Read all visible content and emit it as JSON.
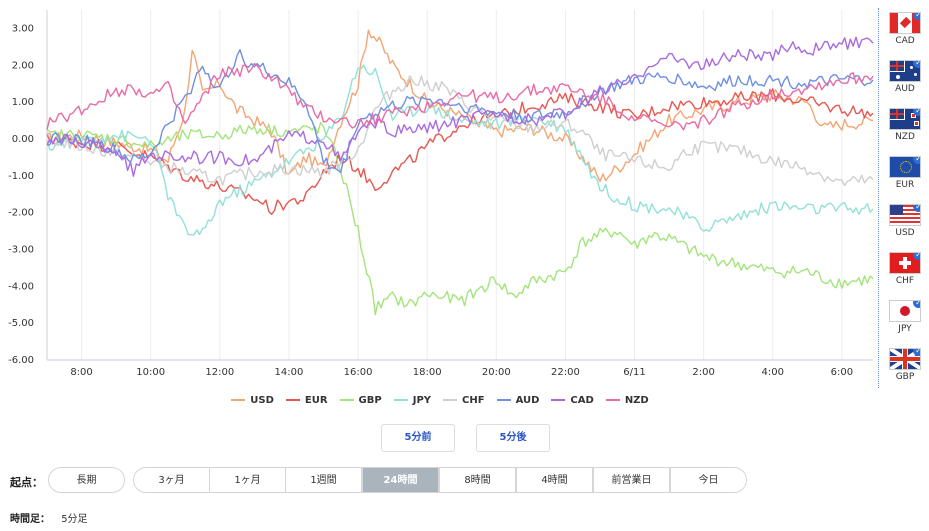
{
  "chart_data": {
    "type": "line",
    "x_ticks": [
      "8:00",
      "10:00",
      "12:00",
      "14:00",
      "16:00",
      "18:00",
      "20:00",
      "22:00",
      "6/11",
      "2:00",
      "4:00",
      "6:00"
    ],
    "y_ticks": [
      "3.00",
      "2.00",
      "1.00",
      "0.00",
      "-1.00",
      "-2.00",
      "-3.00",
      "-4.00",
      "-5.00",
      "-6.00"
    ],
    "ylim": [
      -6,
      3.5
    ],
    "xlim_hours": [
      7,
      30.9
    ],
    "grid": "vertical",
    "legend_position": "bottom",
    "series": [
      {
        "name": "USD",
        "color": "#f4a574",
        "points": [
          [
            7,
            0
          ],
          [
            8,
            0.1
          ],
          [
            9,
            -0.1
          ],
          [
            10,
            -0.3
          ],
          [
            10.5,
            -0.6
          ],
          [
            11,
            0.8
          ],
          [
            11.2,
            2.5
          ],
          [
            11.5,
            1.2
          ],
          [
            12,
            1.5
          ],
          [
            12.5,
            0.8
          ],
          [
            13,
            0.5
          ],
          [
            13.5,
            0.2
          ],
          [
            14,
            -1.0
          ],
          [
            14.5,
            -0.5
          ],
          [
            15,
            -0.8
          ],
          [
            15.5,
            0.5
          ],
          [
            16,
            1.5
          ],
          [
            16.3,
            3.0
          ],
          [
            16.7,
            2.5
          ],
          [
            17,
            2.0
          ],
          [
            17.5,
            1.5
          ],
          [
            18,
            1.0
          ],
          [
            18.5,
            0.8
          ],
          [
            19,
            0.6
          ],
          [
            20,
            0.2
          ],
          [
            21,
            0.3
          ],
          [
            22,
            0.0
          ],
          [
            22.5,
            -0.5
          ],
          [
            23,
            -1.1
          ],
          [
            23.5,
            -0.8
          ],
          [
            24,
            -0.4
          ],
          [
            25,
            0.5
          ],
          [
            26,
            0.8
          ],
          [
            27,
            1.0
          ],
          [
            28,
            1.2
          ],
          [
            29,
            1.0
          ],
          [
            29.5,
            0.3
          ],
          [
            30,
            0.4
          ],
          [
            30.9,
            0.5
          ]
        ]
      },
      {
        "name": "EUR",
        "color": "#e8574f",
        "points": [
          [
            7,
            0
          ],
          [
            8,
            -0.1
          ],
          [
            9,
            -0.2
          ],
          [
            10,
            -0.5
          ],
          [
            11,
            -1.0
          ],
          [
            12,
            -1.3
          ],
          [
            13,
            -1.6
          ],
          [
            13.5,
            -1.9
          ],
          [
            14,
            -1.7
          ],
          [
            14.5,
            -1.6
          ],
          [
            15,
            -0.9
          ],
          [
            15.5,
            -0.5
          ],
          [
            16,
            -0.8
          ],
          [
            16.5,
            -1.3
          ],
          [
            17,
            -0.9
          ],
          [
            17.5,
            -0.6
          ],
          [
            18,
            -0.2
          ],
          [
            19,
            0.4
          ],
          [
            20,
            0.6
          ],
          [
            21,
            0.9
          ],
          [
            22,
            1.1
          ],
          [
            23,
            0.9
          ],
          [
            24,
            0.6
          ],
          [
            25,
            0.9
          ],
          [
            26,
            1.0
          ],
          [
            27,
            1.1
          ],
          [
            28,
            1.2
          ],
          [
            29,
            1.0
          ],
          [
            30,
            0.8
          ],
          [
            30.9,
            0.7
          ]
        ]
      },
      {
        "name": "GBP",
        "color": "#a3e47d",
        "points": [
          [
            7,
            0.1
          ],
          [
            8,
            0.1
          ],
          [
            9,
            0.0
          ],
          [
            10,
            -0.2
          ],
          [
            11,
            0.1
          ],
          [
            12,
            0.1
          ],
          [
            13,
            0.3
          ],
          [
            14,
            0.2
          ],
          [
            15,
            0.3
          ],
          [
            15.5,
            -0.8
          ],
          [
            16,
            -2.5
          ],
          [
            16.5,
            -4.6
          ],
          [
            17,
            -4.3
          ],
          [
            17.5,
            -4.5
          ],
          [
            18,
            -4.2
          ],
          [
            19,
            -4.4
          ],
          [
            20,
            -3.8
          ],
          [
            20.5,
            -4.3
          ],
          [
            21,
            -3.9
          ],
          [
            22,
            -3.6
          ],
          [
            22.5,
            -2.8
          ],
          [
            23,
            -2.6
          ],
          [
            23.5,
            -2.5
          ],
          [
            24,
            -2.9
          ],
          [
            24.5,
            -2.6
          ],
          [
            25,
            -2.7
          ],
          [
            26,
            -3.2
          ],
          [
            27,
            -3.4
          ],
          [
            28,
            -3.6
          ],
          [
            29,
            -3.6
          ],
          [
            29.5,
            -3.8
          ],
          [
            30,
            -3.9
          ],
          [
            30.9,
            -3.8
          ]
        ]
      },
      {
        "name": "JPY",
        "color": "#93e0d8",
        "points": [
          [
            7,
            -0.2
          ],
          [
            8,
            0.0
          ],
          [
            9,
            0.1
          ],
          [
            10,
            0.0
          ],
          [
            10.5,
            -1.5
          ],
          [
            11,
            -2.5
          ],
          [
            11.5,
            -2.6
          ],
          [
            12,
            -1.7
          ],
          [
            13,
            -1.2
          ],
          [
            14,
            -0.6
          ],
          [
            15,
            0.0
          ],
          [
            15.5,
            0.6
          ],
          [
            16,
            2.0
          ],
          [
            16.5,
            1.8
          ],
          [
            17,
            0.6
          ],
          [
            18,
            0.9
          ],
          [
            19,
            0.5
          ],
          [
            20,
            0.4
          ],
          [
            21,
            0.6
          ],
          [
            22,
            0.3
          ],
          [
            22.5,
            -0.5
          ],
          [
            23,
            -1.3
          ],
          [
            23.5,
            -1.6
          ],
          [
            24,
            -1.8
          ],
          [
            25,
            -1.9
          ],
          [
            26,
            -2.4
          ],
          [
            27,
            -2.1
          ],
          [
            28,
            -1.8
          ],
          [
            29,
            -1.9
          ],
          [
            30,
            -1.9
          ],
          [
            30.9,
            -1.9
          ]
        ]
      },
      {
        "name": "CHF",
        "color": "#cfcfcf",
        "points": [
          [
            7,
            0.0
          ],
          [
            8,
            -0.2
          ],
          [
            9,
            -0.4
          ],
          [
            10,
            -0.6
          ],
          [
            11,
            -0.9
          ],
          [
            12,
            -1.1
          ],
          [
            13,
            -0.9
          ],
          [
            14,
            -0.8
          ],
          [
            15,
            -0.9
          ],
          [
            16,
            -0.3
          ],
          [
            16.5,
            0.8
          ],
          [
            17,
            1.3
          ],
          [
            17.5,
            1.6
          ],
          [
            18,
            1.5
          ],
          [
            18.5,
            1.4
          ],
          [
            19,
            1.0
          ],
          [
            20,
            0.5
          ],
          [
            21,
            0.3
          ],
          [
            22,
            0.4
          ],
          [
            22.5,
            0.2
          ],
          [
            23,
            -0.4
          ],
          [
            24,
            -0.6
          ],
          [
            25,
            -0.8
          ],
          [
            25.5,
            -0.3
          ],
          [
            26,
            -0.2
          ],
          [
            27,
            -0.3
          ],
          [
            28,
            -0.6
          ],
          [
            29,
            -0.8
          ],
          [
            30,
            -1.2
          ],
          [
            30.9,
            -1.1
          ]
        ]
      },
      {
        "name": "AUD",
        "color": "#6f8fe0",
        "points": [
          [
            7,
            0.0
          ],
          [
            8,
            0.0
          ],
          [
            9,
            -0.3
          ],
          [
            9.5,
            -0.6
          ],
          [
            10,
            -0.4
          ],
          [
            10.5,
            0.4
          ],
          [
            11,
            1.1
          ],
          [
            11.5,
            2.0
          ],
          [
            12,
            1.3
          ],
          [
            12.5,
            2.3
          ],
          [
            13,
            2.0
          ],
          [
            13.5,
            1.8
          ],
          [
            14,
            1.5
          ],
          [
            14.5,
            1.0
          ],
          [
            15,
            -0.6
          ],
          [
            15.5,
            -0.9
          ],
          [
            16,
            0.5
          ],
          [
            17,
            0.9
          ],
          [
            18,
            1.1
          ],
          [
            19,
            0.9
          ],
          [
            20,
            0.7
          ],
          [
            21,
            0.6
          ],
          [
            22,
            0.7
          ],
          [
            23,
            1.3
          ],
          [
            24,
            1.6
          ],
          [
            25,
            1.7
          ],
          [
            26,
            1.4
          ],
          [
            27,
            1.6
          ],
          [
            28,
            1.6
          ],
          [
            29,
            1.5
          ],
          [
            30,
            1.6
          ],
          [
            30.9,
            1.6
          ]
        ]
      },
      {
        "name": "CAD",
        "color": "#a86be0",
        "points": [
          [
            7,
            0.0
          ],
          [
            8,
            -0.1
          ],
          [
            9,
            -0.3
          ],
          [
            9.5,
            -0.9
          ],
          [
            10,
            -0.4
          ],
          [
            11,
            -0.5
          ],
          [
            12,
            -0.5
          ],
          [
            13,
            -0.6
          ],
          [
            14,
            0.1
          ],
          [
            15,
            0.0
          ],
          [
            15.5,
            -0.6
          ],
          [
            16,
            0.2
          ],
          [
            16.5,
            0.4
          ],
          [
            17,
            0.2
          ],
          [
            18,
            0.3
          ],
          [
            19,
            0.5
          ],
          [
            20,
            0.7
          ],
          [
            21,
            0.5
          ],
          [
            22,
            0.7
          ],
          [
            23,
            1.3
          ],
          [
            24,
            1.6
          ],
          [
            24.5,
            2.1
          ],
          [
            25,
            2.2
          ],
          [
            26,
            2.0
          ],
          [
            27,
            2.3
          ],
          [
            28,
            2.2
          ],
          [
            28.5,
            2.6
          ],
          [
            29,
            2.4
          ],
          [
            30,
            2.6
          ],
          [
            30.9,
            2.6
          ]
        ]
      },
      {
        "name": "NZD",
        "color": "#e96ba5",
        "points": [
          [
            7,
            0.4
          ],
          [
            7.5,
            0.6
          ],
          [
            8,
            0.8
          ],
          [
            9,
            1.3
          ],
          [
            9.5,
            1.4
          ],
          [
            10,
            1.2
          ],
          [
            10.5,
            1.4
          ],
          [
            11,
            0.4
          ],
          [
            12,
            1.8
          ],
          [
            13,
            1.9
          ],
          [
            13.5,
            1.7
          ],
          [
            14,
            1.3
          ],
          [
            14.5,
            0.8
          ],
          [
            15,
            0.6
          ],
          [
            16,
            0.4
          ],
          [
            17,
            0.7
          ],
          [
            18,
            0.9
          ],
          [
            19,
            1.2
          ],
          [
            20,
            1.1
          ],
          [
            21,
            1.3
          ],
          [
            22,
            1.4
          ],
          [
            23,
            1.1
          ],
          [
            24,
            0.6
          ],
          [
            25,
            0.3
          ],
          [
            26,
            0.5
          ],
          [
            27,
            0.9
          ],
          [
            28,
            1.2
          ],
          [
            29,
            1.4
          ],
          [
            30,
            1.6
          ],
          [
            30.9,
            1.7
          ]
        ]
      }
    ]
  },
  "flags": [
    {
      "code": "CAD",
      "name": "cad-flag-icon",
      "checked": true
    },
    {
      "code": "AUD",
      "name": "aud-flag-icon",
      "checked": true
    },
    {
      "code": "NZD",
      "name": "nzd-flag-icon",
      "checked": true
    },
    {
      "code": "EUR",
      "name": "eur-flag-icon",
      "checked": true
    },
    {
      "code": "USD",
      "name": "usd-flag-icon",
      "checked": true
    },
    {
      "code": "CHF",
      "name": "chf-flag-icon",
      "checked": true
    },
    {
      "code": "JPY",
      "name": "jpy-flag-icon",
      "checked": true
    },
    {
      "code": "GBP",
      "name": "gbp-flag-icon",
      "checked": true
    }
  ],
  "check_mark": "✓",
  "nav": {
    "prev": "5分前",
    "next": "5分後"
  },
  "range": {
    "label": "起点：",
    "long": "長期",
    "options": [
      "3ヶ月",
      "1ヶ月",
      "1週間",
      "24時間",
      "8時間",
      "4時間",
      "前営業日",
      "今日"
    ],
    "active": "24時間"
  },
  "interval": {
    "label": "時間足：",
    "value": "5分足"
  }
}
